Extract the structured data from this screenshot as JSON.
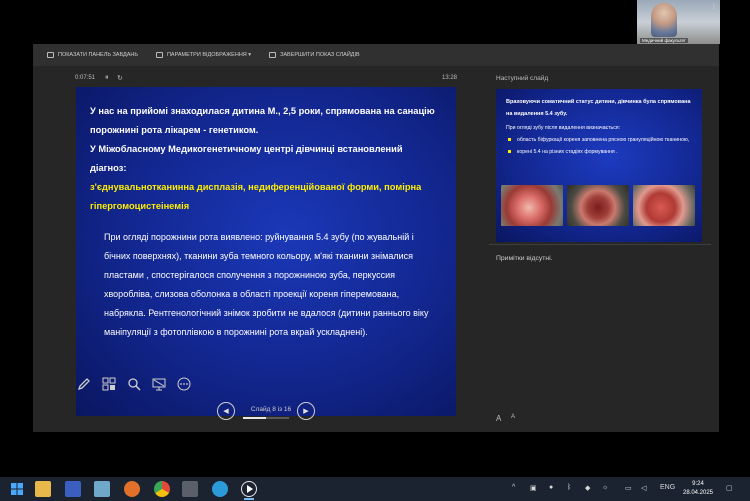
{
  "video": {
    "name": "Медичний факультет",
    "more_icon": "dots-icon"
  },
  "toolbar": {
    "show_taskbar": "ПОКАЗАТИ ПАНЕЛЬ ЗАВДАНЬ",
    "display_settings": "ПАРАМЕТРИ ВІДОБРАЖЕННЯ ▾",
    "end_show": "ЗАВЕРШИТИ ПОКАЗ СЛАЙДІВ"
  },
  "timer": {
    "elapsed": "0:07:51",
    "clock": "13:28",
    "pause_icon": "⏸",
    "reset_icon": "↻"
  },
  "slide": {
    "intro": "У нас на прийомі знаходилася дитина М., 2,5 роки, спрямована на санацію порожнині рота лікарем - генетиком.",
    "center": "У Міжобласному Медикогенетичному центрі дівчинці встановлений діагноз:",
    "diagnosis": "з'єднувальнотканинна дисплазія, недиференційованої форми, помірна гіпергомоцистеінемія",
    "body": "При огляді порожнини рота виявлено: руйнування 5.4 зубу (по жувальній і бічних поверхнях), тканини зуба темного кольору, м'які тканини знімалися пластами , спостерігалося сполучення з порожниною зуба, перкуссия хворобліва, слизова оболонка в області проекції кореня гіперемована, набрякла. Рентгенологічний знімок зробити не вдалося (дитини раннього віку маніпуляції з фотоплівкою в порожнині рота вкрай ускладнені)."
  },
  "nav": {
    "label": "Слайд 8 із 16",
    "progress": 0.5,
    "prev_icon": "◀",
    "next_icon": "▶"
  },
  "next_slide": {
    "label": "Наступний слайд",
    "lead": "Враховуючи соматичний статус дитини, дівчинка була спрямована на видалення 5.4 зубу.",
    "text": "При огляді зубу після видалення визначається:",
    "items": [
      "область біфуркації кореня заповнена рясною грануляційною тканиною,",
      "корені 5.4 на різних стадіях формування ."
    ]
  },
  "notes": {
    "text": "Примітки відсутні.",
    "font_increase": "A",
    "font_decrease": "A"
  },
  "taskbar": {
    "lang": "ENG",
    "time": "9:24",
    "date": "28.04.2025",
    "apps": [
      "windows-icon",
      "search-icon",
      "file-explorer-icon",
      "app-icon",
      "app-icon",
      "firefox-icon",
      "chrome-icon",
      "calculator-icon",
      "edge-icon",
      "media-player-icon"
    ]
  },
  "colors": {
    "slide_bg": "#12268e",
    "highlight": "#ffee00",
    "panel": "#262626",
    "taskbar": "#1c2330"
  }
}
